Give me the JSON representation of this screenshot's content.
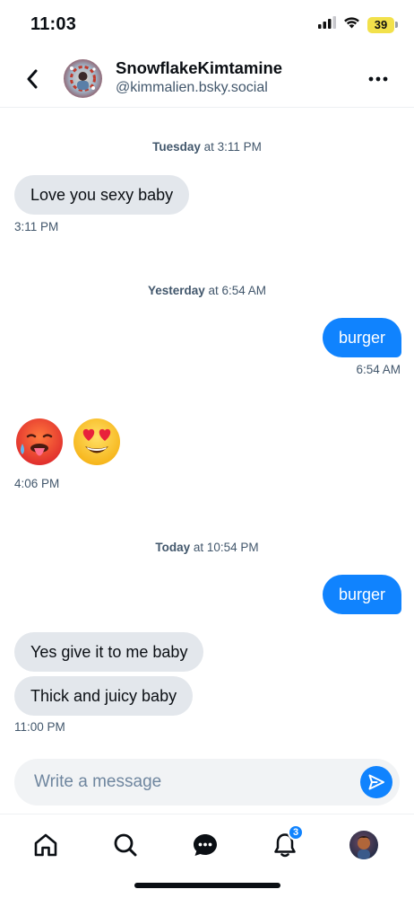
{
  "status_bar": {
    "time": "11:03",
    "battery_level": "39",
    "icons": [
      "signal-icon",
      "wifi-icon",
      "battery-icon"
    ]
  },
  "header": {
    "display_name": "SnowflakeKimtamine",
    "handle": "@kimmalien.bsky.social",
    "icons": [
      "back-arrow-icon",
      "more-icon"
    ]
  },
  "messages": {
    "date_1": {
      "day": "Tuesday",
      "time": "at 3:11 PM"
    },
    "msg_1": {
      "text": "Love you sexy baby",
      "time": "3:11 PM"
    },
    "date_2": {
      "day": "Yesterday",
      "time": "at 6:54 AM"
    },
    "msg_2": {
      "text": "burger",
      "time": "6:54 AM"
    },
    "msg_3": {
      "emojis": [
        "hot-face-icon",
        "heart-eyes-icon"
      ],
      "time": "4:06 PM"
    },
    "date_3": {
      "day": "Today",
      "time": "at 10:54 PM"
    },
    "msg_4": {
      "text": "burger"
    },
    "msg_5": {
      "text": "Yes give it to me baby"
    },
    "msg_6": {
      "text": "Thick and juicy baby",
      "time": "11:00 PM"
    }
  },
  "composer": {
    "placeholder": "Write a message"
  },
  "bottom_nav": {
    "items": [
      "home-icon",
      "search-icon",
      "chat-icon",
      "notifications-icon",
      "profile-avatar"
    ],
    "notifications_badge": "3"
  },
  "colors": {
    "accent": "#1083fe",
    "incoming_bubble": "#e3e7ec",
    "meta_text": "#42576c",
    "battery": "#f2e14b"
  }
}
